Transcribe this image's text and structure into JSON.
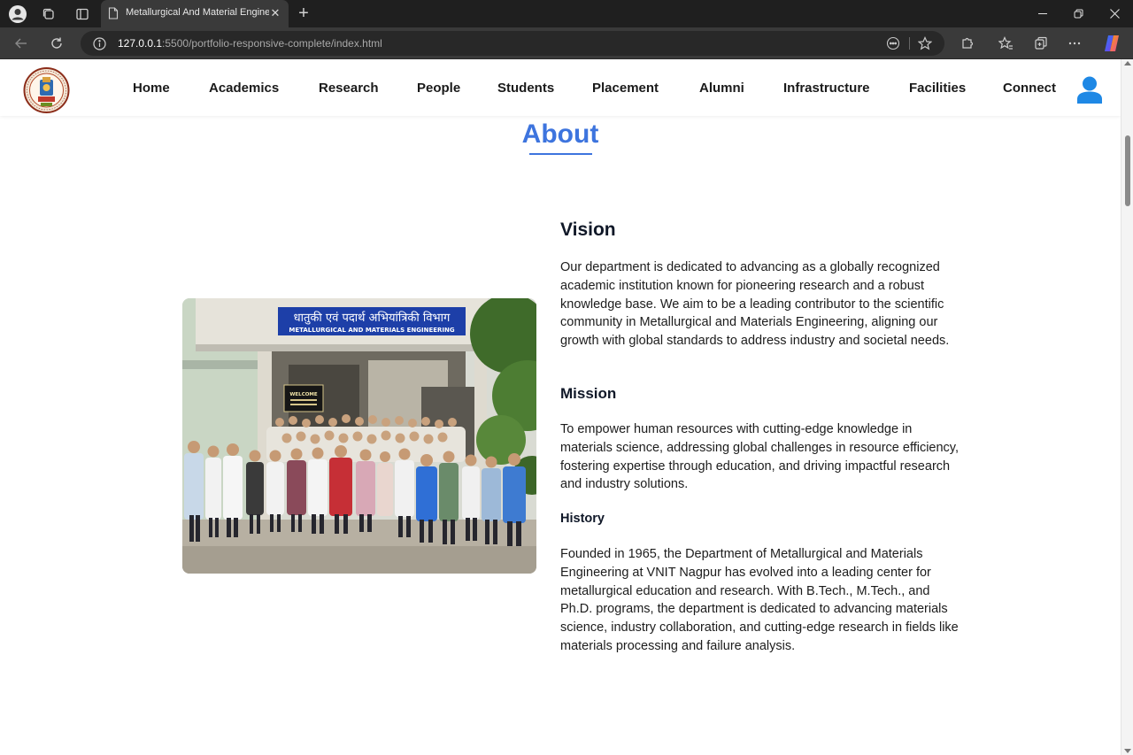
{
  "browser": {
    "tab_title": "Metallurgical And Material Engineering",
    "url_host": "127.0.0.1",
    "url_rest": ":5500/portfolio-responsive-complete/index.html"
  },
  "site": {
    "nav": [
      "Home",
      "Academics",
      "Research",
      "People",
      "Students",
      "Placement",
      "Alumni",
      "Infrastructure",
      "Facilities",
      "Connect"
    ]
  },
  "about": {
    "title": "About",
    "vision_heading": "Vision",
    "vision_text": "Our department is dedicated to advancing as a globally recognized academic institution known for pioneering research and a robust knowledge base. We aim to be a leading contributor to the scientific community in Metallurgical and Materials Engineering, aligning our growth with global standards to address industry and societal needs.",
    "mission_heading": "Mission",
    "mission_text": "To empower human resources with cutting-edge knowledge in materials science, addressing global challenges in resource efficiency, fostering expertise through education, and driving impactful research and industry solutions.",
    "history_heading": "History",
    "history_text": "Founded in 1965, the Department of Metallurgical and Materials Engineering at VNIT Nagpur has evolved into a leading center for metallurgical education and research. With B.Tech., M.Tech., and Ph.D. programs, the department is dedicated to advancing materials science, industry collaboration, and cutting-edge research in fields like materials processing and failure analysis.",
    "photo_sign_hindi": "धातुकी एवं पदार्थ अभियांत्रिकी विभाग",
    "photo_sign_english": "METALLURGICAL AND MATERIALS ENGINEERING",
    "photo_board": "WELCOME"
  },
  "colors": {
    "accent": "#3d74de",
    "user_icon": "#1e88e5",
    "chrome_dark": "#1f1f1f",
    "chrome_mid": "#3a3a3a"
  },
  "icons": [
    "profile-icon",
    "workspaces-icon",
    "tab-actions-icon",
    "page-icon",
    "close-icon",
    "plus-icon",
    "minimize-icon",
    "restore-icon",
    "back-icon",
    "refresh-icon",
    "info-icon",
    "reader-icon",
    "star-icon",
    "extensions-icon",
    "favorites-icon",
    "collections-icon",
    "more-icon",
    "copilot-icon",
    "user-icon"
  ]
}
